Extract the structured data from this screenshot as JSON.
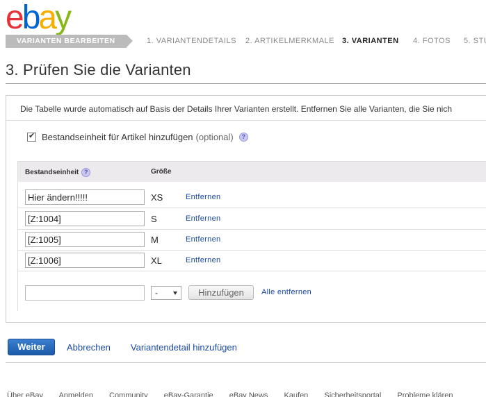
{
  "brand": {
    "letters": [
      {
        "ch": "e",
        "color": "#e53238"
      },
      {
        "ch": "b",
        "color": "#0064d2"
      },
      {
        "ch": "a",
        "color": "#f5af02"
      },
      {
        "ch": "y",
        "color": "#86b817"
      }
    ]
  },
  "steps": {
    "active_section": "VARIANTEN BEARBEITEN",
    "items": [
      {
        "label": "1. VARIANTENDETAILS",
        "current": false
      },
      {
        "label": "2. ARTIKELMERKMALE",
        "current": false
      },
      {
        "label": "3. VARIANTEN",
        "current": true
      },
      {
        "label": "4. FOTOS",
        "current": false
      },
      {
        "label": "5. STU",
        "current": false
      }
    ]
  },
  "page": {
    "title": "3. Prüfen Sie die Varianten",
    "intro": "Die Tabelle wurde automatisch auf Basis der Details Ihrer Varianten erstellt. Entfernen Sie alle Varianten, die Sie nich"
  },
  "sku_option": {
    "label": "Bestandseinheit für Artikel hinzufügen",
    "optional": "(optional)",
    "checked": true,
    "help_icon": "help-icon"
  },
  "table": {
    "headers": {
      "sku": "Bestandseinheit",
      "size": "Größe"
    },
    "rows": [
      {
        "sku": "Hier ändern!!!!!",
        "size": "XS",
        "remove": "Entfernen"
      },
      {
        "sku": "[Z:1004]",
        "size": "S",
        "remove": "Entfernen"
      },
      {
        "sku": "[Z:1005]",
        "size": "M",
        "remove": "Entfernen"
      },
      {
        "sku": "[Z:1006]",
        "size": "XL",
        "remove": "Entfernen"
      }
    ],
    "add_row": {
      "sku_value": "",
      "size_selected": "-",
      "add_label": "Hinzufügen",
      "remove_all_label": "Alle entfernen"
    }
  },
  "actions": {
    "continue": "Weiter",
    "cancel": "Abbrechen",
    "add_detail": "Variantendetail hinzufügen"
  },
  "footer": {
    "links": [
      "Über eBay",
      "Anmelden",
      "Community",
      "eBay-Garantie",
      "eBay News",
      "Kaufen",
      "Sicherheitsportal",
      "Probleme klären"
    ]
  }
}
